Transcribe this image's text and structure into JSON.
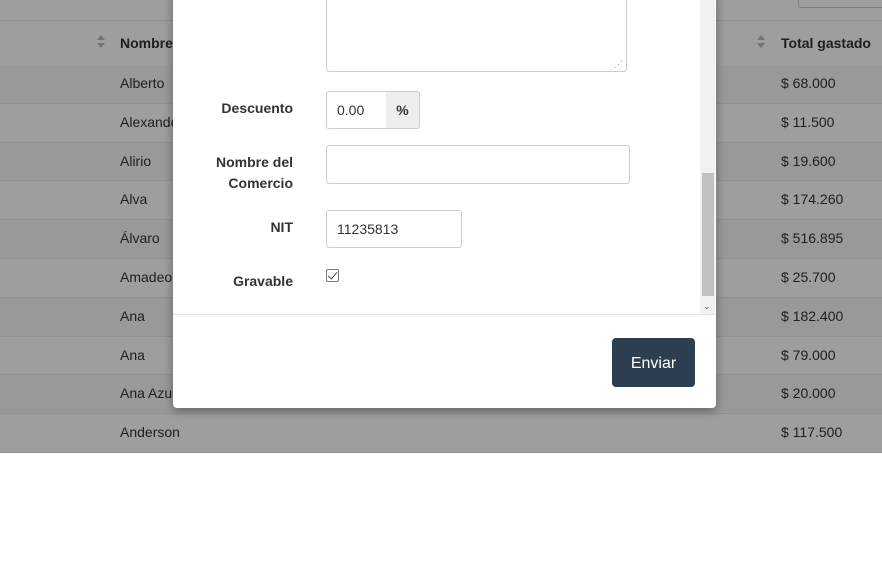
{
  "table": {
    "columns": {
      "nombre": "Nombre",
      "total": "Total gastado"
    },
    "rows": [
      {
        "nombre": "Alberto",
        "total": "$ 68.000"
      },
      {
        "nombre": "Alexande",
        "total": "$ 11.500"
      },
      {
        "nombre": "Alirio",
        "total": "$ 19.600"
      },
      {
        "nombre": "Alva",
        "total": "$ 174.260"
      },
      {
        "nombre": "Álvaro",
        "total": "$ 516.895"
      },
      {
        "nombre": "Amadeo",
        "total": "$ 25.700"
      },
      {
        "nombre": "Ana",
        "total": "$ 182.400"
      },
      {
        "nombre": "Ana",
        "total": "$ 79.000"
      },
      {
        "nombre": "Ana Azu",
        "total": "$ 20.000"
      },
      {
        "nombre": "Anderson",
        "total": "$ 117.500"
      }
    ]
  },
  "modal": {
    "form": {
      "descuento_label": "Descuento",
      "descuento_value": "0.00",
      "descuento_addon": "%",
      "comercio_label_line1": "Nombre del",
      "comercio_label_line2": "Comercio",
      "comercio_value": "",
      "nit_label": "NIT",
      "nit_value": "11235813",
      "gravable_label": "Gravable",
      "gravable_checked": true
    },
    "submit_label": "Enviar"
  },
  "colors": {
    "button_bg": "#2c3e50",
    "overlay": "rgba(0,0,0,0.38)"
  }
}
